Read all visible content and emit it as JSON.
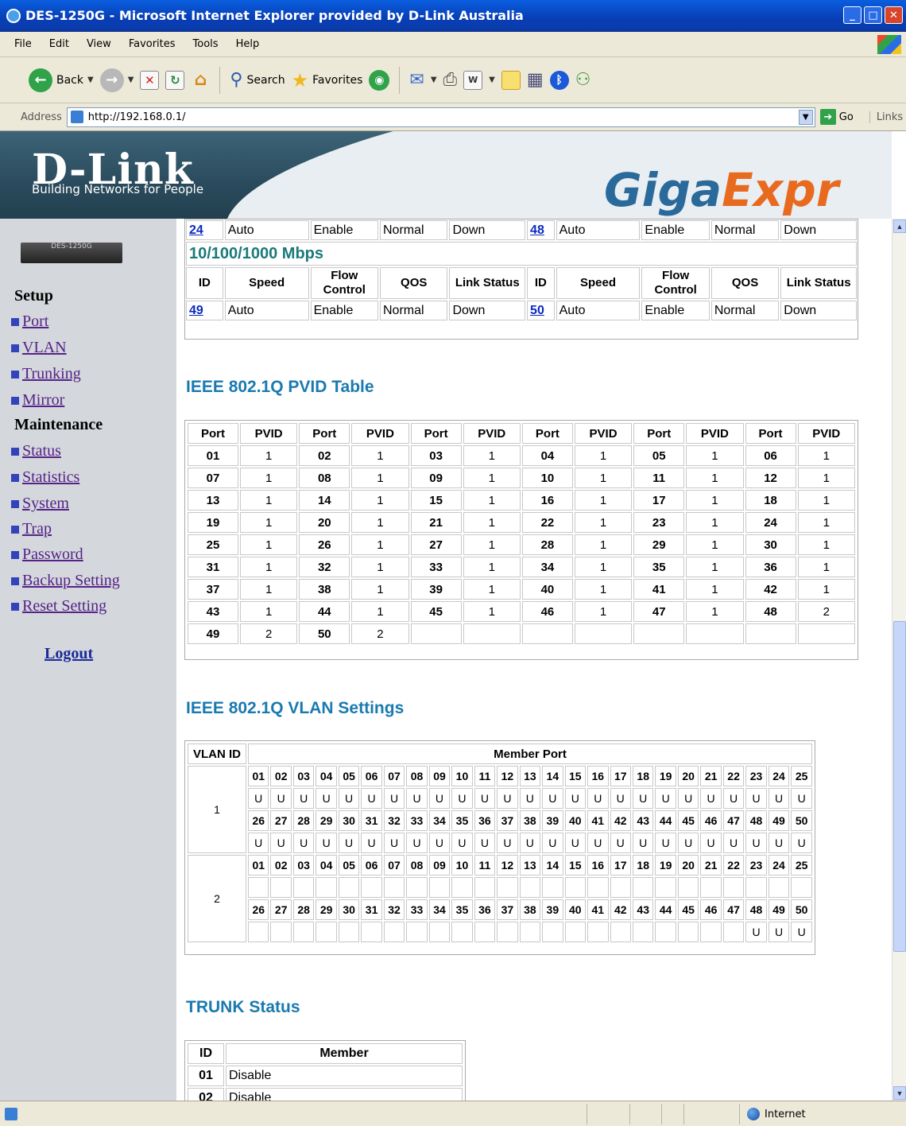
{
  "window": {
    "title": "DES-1250G - Microsoft Internet Explorer provided by D-Link Australia"
  },
  "menu": [
    "File",
    "Edit",
    "View",
    "Favorites",
    "Tools",
    "Help"
  ],
  "toolbar": {
    "back": "Back",
    "search": "Search",
    "favorites": "Favorites"
  },
  "address": {
    "label": "Address",
    "url": "http://192.168.0.1/",
    "go": "Go",
    "links": "Links"
  },
  "banner": {
    "logo": "D-Link",
    "tagline": "Building Networks for People",
    "giga": "Giga",
    "express": "Expr"
  },
  "sidebar": {
    "device_label": "DES-1250G",
    "setup_title": "Setup",
    "setup_items": [
      "Port",
      "VLAN",
      "Trunking",
      "Mirror"
    ],
    "maintenance_title": "Maintenance",
    "maintenance_items": [
      "Status",
      "Statistics",
      "System",
      "Trap",
      "Password",
      "Backup Setting",
      "Reset Setting"
    ],
    "logout": "Logout"
  },
  "port_status": {
    "top_row": [
      {
        "id": "24",
        "speed": "Auto",
        "flow": "Enable",
        "qos": "Normal",
        "link": "Down"
      },
      {
        "id": "48",
        "speed": "Auto",
        "flow": "Enable",
        "qos": "Normal",
        "link": "Down"
      }
    ],
    "gig_title": "10/100/1000 Mbps",
    "headers": {
      "id": "ID",
      "speed": "Speed",
      "flow": "Flow Control",
      "qos": "QOS",
      "link": "Link Status"
    },
    "gig_row": [
      {
        "id": "49",
        "speed": "Auto",
        "flow": "Enable",
        "qos": "Normal",
        "link": "Down"
      },
      {
        "id": "50",
        "speed": "Auto",
        "flow": "Enable",
        "qos": "Normal",
        "link": "Down"
      }
    ]
  },
  "pvid_table": {
    "title": "IEEE 802.1Q PVID Table",
    "port_header": "Port",
    "pvid_header": "PVID",
    "rows": [
      [
        [
          "01",
          "1"
        ],
        [
          "02",
          "1"
        ],
        [
          "03",
          "1"
        ],
        [
          "04",
          "1"
        ],
        [
          "05",
          "1"
        ],
        [
          "06",
          "1"
        ]
      ],
      [
        [
          "07",
          "1"
        ],
        [
          "08",
          "1"
        ],
        [
          "09",
          "1"
        ],
        [
          "10",
          "1"
        ],
        [
          "11",
          "1"
        ],
        [
          "12",
          "1"
        ]
      ],
      [
        [
          "13",
          "1"
        ],
        [
          "14",
          "1"
        ],
        [
          "15",
          "1"
        ],
        [
          "16",
          "1"
        ],
        [
          "17",
          "1"
        ],
        [
          "18",
          "1"
        ]
      ],
      [
        [
          "19",
          "1"
        ],
        [
          "20",
          "1"
        ],
        [
          "21",
          "1"
        ],
        [
          "22",
          "1"
        ],
        [
          "23",
          "1"
        ],
        [
          "24",
          "1"
        ]
      ],
      [
        [
          "25",
          "1"
        ],
        [
          "26",
          "1"
        ],
        [
          "27",
          "1"
        ],
        [
          "28",
          "1"
        ],
        [
          "29",
          "1"
        ],
        [
          "30",
          "1"
        ]
      ],
      [
        [
          "31",
          "1"
        ],
        [
          "32",
          "1"
        ],
        [
          "33",
          "1"
        ],
        [
          "34",
          "1"
        ],
        [
          "35",
          "1"
        ],
        [
          "36",
          "1"
        ]
      ],
      [
        [
          "37",
          "1"
        ],
        [
          "38",
          "1"
        ],
        [
          "39",
          "1"
        ],
        [
          "40",
          "1"
        ],
        [
          "41",
          "1"
        ],
        [
          "42",
          "1"
        ]
      ],
      [
        [
          "43",
          "1"
        ],
        [
          "44",
          "1"
        ],
        [
          "45",
          "1"
        ],
        [
          "46",
          "1"
        ],
        [
          "47",
          "1"
        ],
        [
          "48",
          "2"
        ]
      ],
      [
        [
          "49",
          "2"
        ],
        [
          "50",
          "2"
        ],
        [
          "",
          ""
        ],
        [
          "",
          ""
        ],
        [
          "",
          ""
        ],
        [
          "",
          ""
        ]
      ]
    ]
  },
  "vlan_settings": {
    "title": "IEEE 802.1Q VLAN Settings",
    "vlan_id_header": "VLAN ID",
    "member_port_header": "Member Port",
    "ports_a": [
      "01",
      "02",
      "03",
      "04",
      "05",
      "06",
      "07",
      "08",
      "09",
      "10",
      "11",
      "12",
      "13",
      "14",
      "15",
      "16",
      "17",
      "18",
      "19",
      "20",
      "21",
      "22",
      "23",
      "24",
      "25"
    ],
    "ports_b": [
      "26",
      "27",
      "28",
      "29",
      "30",
      "31",
      "32",
      "33",
      "34",
      "35",
      "36",
      "37",
      "38",
      "39",
      "40",
      "41",
      "42",
      "43",
      "44",
      "45",
      "46",
      "47",
      "48",
      "49",
      "50"
    ],
    "vlans": [
      {
        "id": "1",
        "members_a": [
          "U",
          "U",
          "U",
          "U",
          "U",
          "U",
          "U",
          "U",
          "U",
          "U",
          "U",
          "U",
          "U",
          "U",
          "U",
          "U",
          "U",
          "U",
          "U",
          "U",
          "U",
          "U",
          "U",
          "U",
          "U"
        ],
        "members_b": [
          "U",
          "U",
          "U",
          "U",
          "U",
          "U",
          "U",
          "U",
          "U",
          "U",
          "U",
          "U",
          "U",
          "U",
          "U",
          "U",
          "U",
          "U",
          "U",
          "U",
          "U",
          "U",
          "U",
          "U",
          "U"
        ]
      },
      {
        "id": "2",
        "members_a": [
          "",
          "",
          "",
          "",
          "",
          "",
          "",
          "",
          "",
          "",
          "",
          "",
          "",
          "",
          "",
          "",
          "",
          "",
          "",
          "",
          "",
          "",
          "",
          "",
          ""
        ],
        "members_b": [
          "",
          "",
          "",
          "",
          "",
          "",
          "",
          "",
          "",
          "",
          "",
          "",
          "",
          "",
          "",
          "",
          "",
          "",
          "",
          "",
          "",
          "",
          "U",
          "U",
          "U"
        ]
      }
    ]
  },
  "trunk_status": {
    "title": "TRUNK Status",
    "id_header": "ID",
    "member_header": "Member",
    "rows": [
      [
        "01",
        "Disable"
      ],
      [
        "02",
        "Disable"
      ]
    ]
  },
  "statusbar": {
    "zone": "Internet"
  }
}
